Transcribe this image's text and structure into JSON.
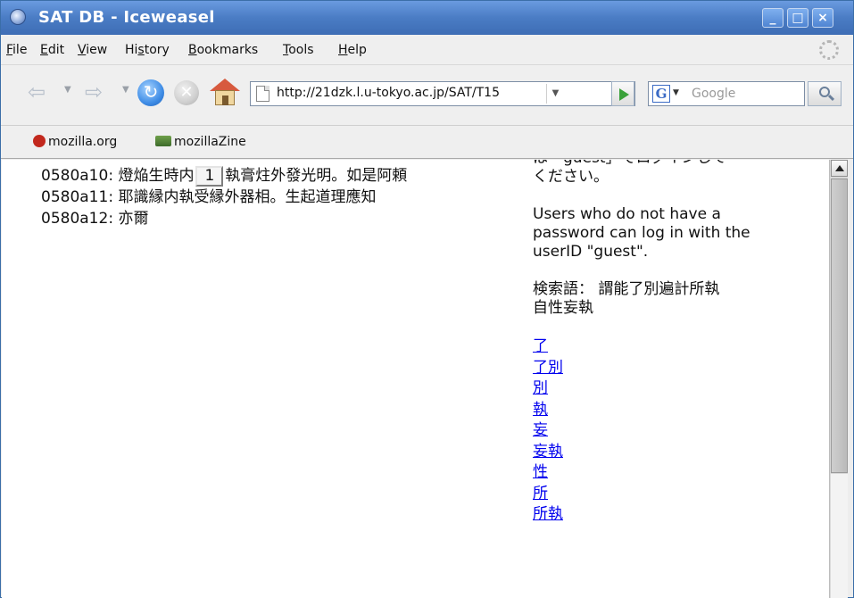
{
  "window": {
    "title": "SAT DB - Iceweasel",
    "controls": {
      "minimize": "_",
      "maximize": "□",
      "close": "×"
    }
  },
  "menu": {
    "items": [
      {
        "label": "File",
        "key": "F",
        "rest": "ile"
      },
      {
        "label": "Edit",
        "key": "E",
        "rest": "dit"
      },
      {
        "label": "View",
        "key": "V",
        "rest": "iew"
      },
      {
        "label": "History",
        "pre": "Hi",
        "key": "s",
        "rest": "tory"
      },
      {
        "label": "Bookmarks",
        "key": "B",
        "rest": "ookmarks"
      },
      {
        "label": "Tools",
        "key": "T",
        "rest": "ools"
      },
      {
        "label": "Help",
        "key": "H",
        "rest": "elp"
      }
    ]
  },
  "navigation": {
    "url": "http://21dzk.l.u-tokyo.ac.jp/SAT/T15",
    "search_placeholder": "Google",
    "search_engine_letter": "G"
  },
  "bookmarks": [
    {
      "label": "mozilla.org",
      "icon": "mozilla-icon"
    },
    {
      "label": "mozillaZine",
      "icon": "mozillazine-icon"
    }
  ],
  "text_lines": [
    {
      "before": "0580a10: 燈焔生時内",
      "note": "1",
      "after": "執膏炷外發光明。如是阿頼"
    },
    {
      "text": "0580a11: 耶識縁内執受縁外器相。生起道理應知"
    },
    {
      "text": "0580a12: 亦爾"
    }
  ],
  "sidebar": {
    "cut_line": "は「guest」でログインして",
    "jp_line": "ください。",
    "users_note": "Users who do not have a password can log in with the userID \"guest\".",
    "search_label": "検索語：",
    "search_terms_line1": "謂能了別遍計所執",
    "search_terms_line2": "自性妄執",
    "term_links": [
      "了",
      "了別",
      "別",
      "執",
      "妄",
      "妄執",
      "性",
      "所",
      "所執"
    ]
  }
}
